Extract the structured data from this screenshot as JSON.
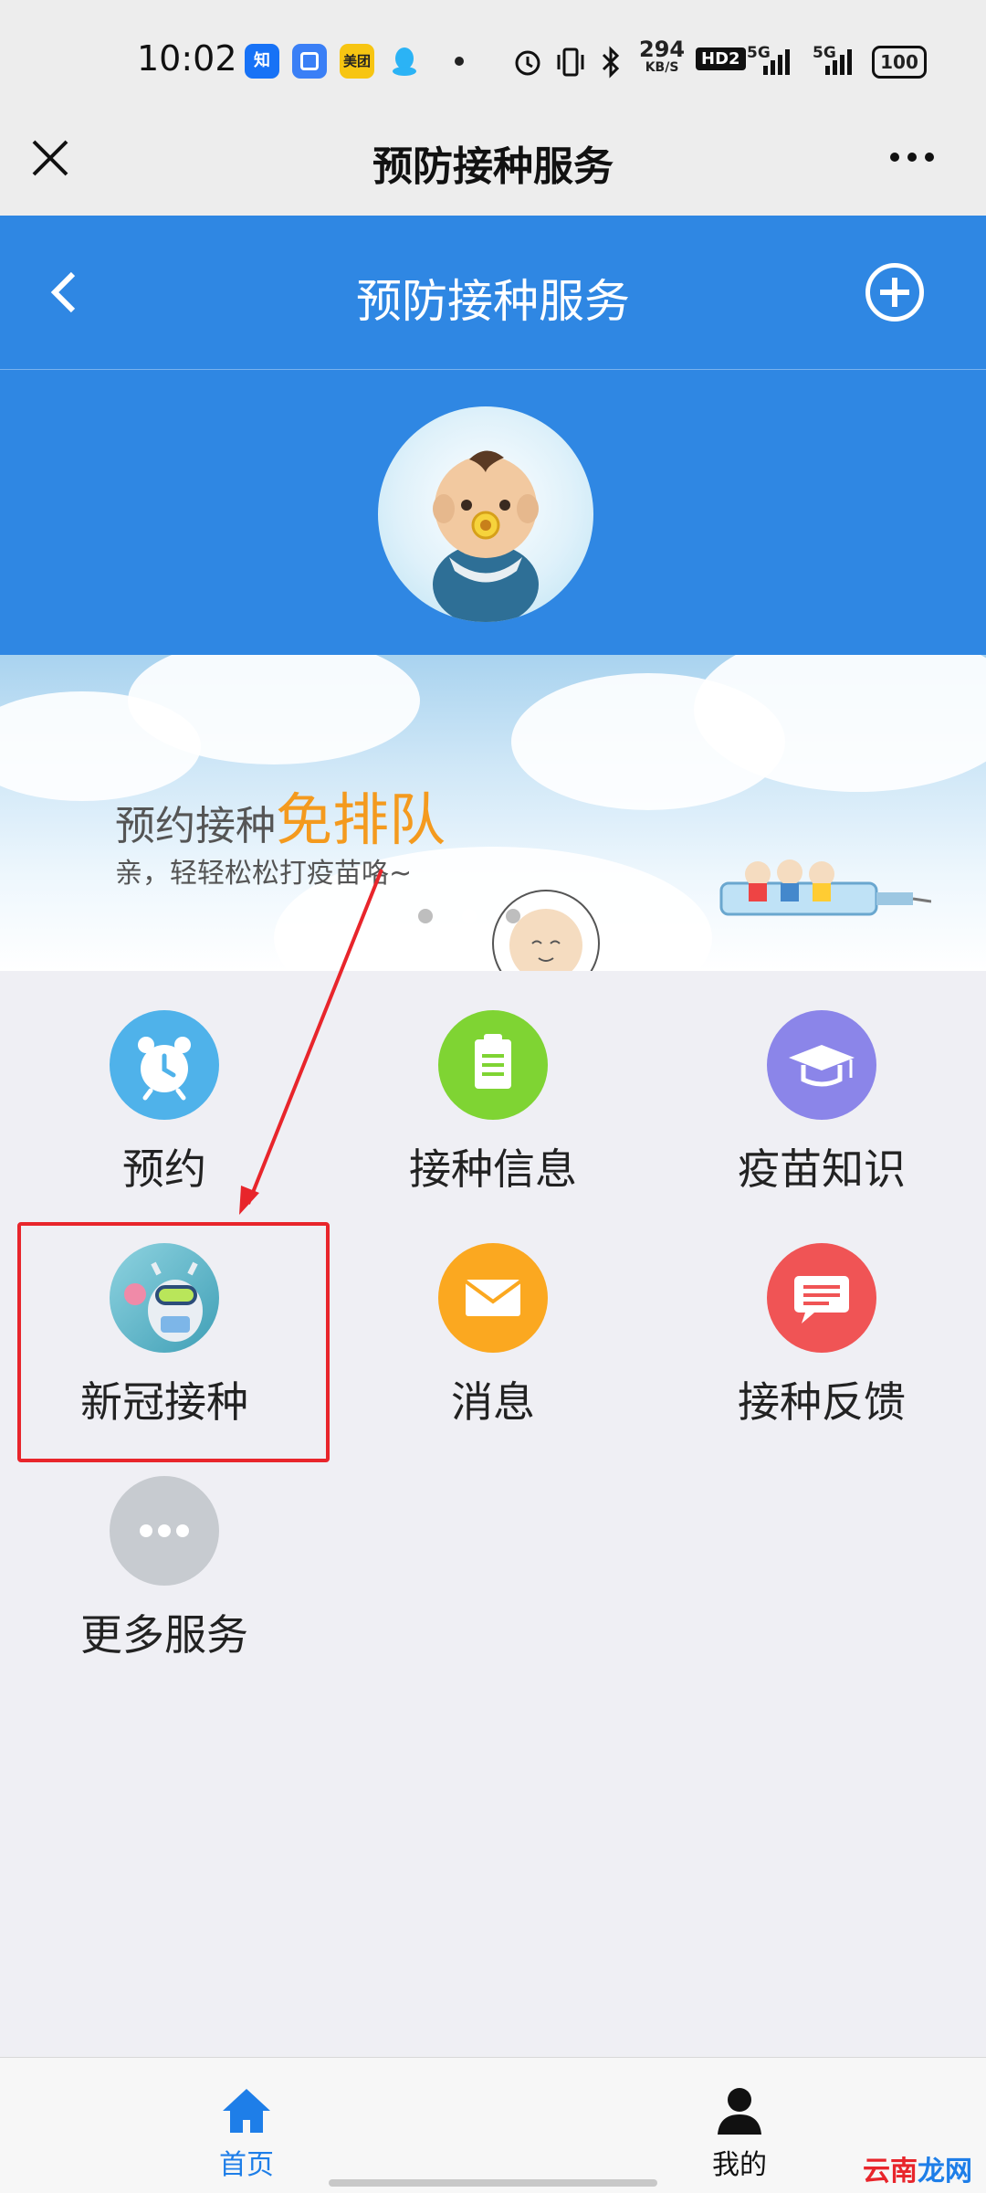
{
  "status_bar": {
    "time": "10:02",
    "apps": [
      {
        "name": "zhihu-icon",
        "text": "知",
        "color": "#1772f6"
      },
      {
        "name": "square-app-icon",
        "text": "",
        "color": "#3a7ff6"
      },
      {
        "name": "meituan-icon",
        "text": "美团",
        "color": "#f7c512"
      },
      {
        "name": "qq-icon",
        "text": "",
        "color": "#2bb3f5"
      }
    ],
    "net_speed_value": "294",
    "net_speed_unit": "KB/S",
    "hd_label": "HD2",
    "signal1_label": "5G",
    "signal2_label": "5G",
    "battery": "100"
  },
  "mini_program_header": {
    "title": "预防接种服务"
  },
  "app_header": {
    "title": "预防接种服务"
  },
  "banner": {
    "title_prefix": "预约接种",
    "title_highlight": "免排队",
    "subtitle": "亲，轻轻松松打疫苗咯~",
    "dots": 3,
    "active_dot": 1
  },
  "services": [
    {
      "id": "appointment",
      "label": "预约",
      "icon": "alarm-clock-icon",
      "color": "#4fb2ea"
    },
    {
      "id": "vaccination-info",
      "label": "接种信息",
      "icon": "clipboard-icon",
      "color": "#7fd433"
    },
    {
      "id": "vaccine-knowledge",
      "label": "疫苗知识",
      "icon": "graduation-cap-icon",
      "color": "#8b85e9"
    },
    {
      "id": "covid-vaccination",
      "label": "新冠接种",
      "icon": "covid-mascot-icon",
      "color": "#56b9c9"
    },
    {
      "id": "messages",
      "label": "消息",
      "icon": "envelope-icon",
      "color": "#fba820"
    },
    {
      "id": "feedback",
      "label": "接种反馈",
      "icon": "chat-bubble-icon",
      "color": "#f05455"
    },
    {
      "id": "more-services",
      "label": "更多服务",
      "icon": "ellipsis-icon",
      "color": "#c7cbd0"
    }
  ],
  "tab_bar": {
    "tabs": [
      {
        "label": "首页",
        "icon": "home-icon",
        "active": true
      },
      {
        "label": "我的",
        "icon": "user-icon",
        "active": false
      }
    ]
  },
  "colors": {
    "primary_blue": "#2f87e3",
    "highlight_red": "#e8252b",
    "tab_active": "#1e7ee8"
  },
  "watermark": {
    "part1": "云南",
    "part2": "龙网"
  }
}
